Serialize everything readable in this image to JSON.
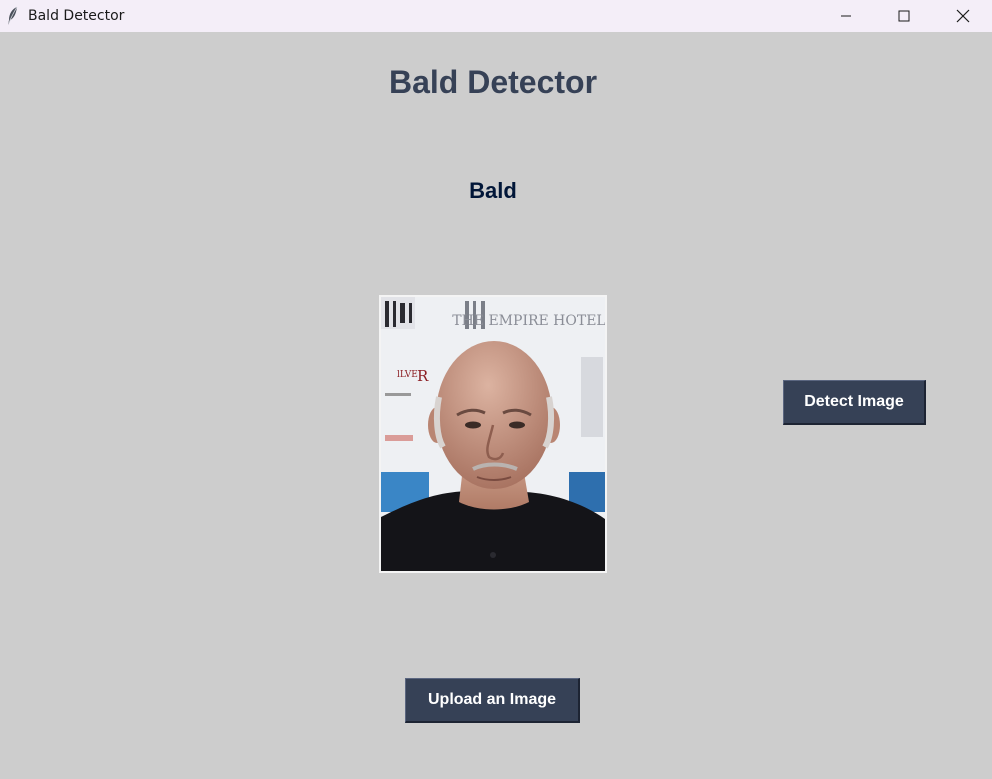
{
  "window": {
    "title": "Bald Detector",
    "app_icon": "feather-icon",
    "controls": {
      "minimize": "minimize-icon",
      "maximize": "maximize-icon",
      "close": "close-icon"
    }
  },
  "main": {
    "heading": "Bald Detector",
    "result_label": "Bald",
    "image": {
      "kind": "photo-portrait",
      "sign_text": "THE EMPIRE HOTEL"
    },
    "detect_button_label": "Detect Image",
    "upload_button_label": "Upload an Image"
  },
  "colors": {
    "background": "#cdcdcd",
    "titlebar": "#f4eef8",
    "heading": "#364156",
    "result": "#011638",
    "button_bg": "#364156",
    "button_text": "#ffffff"
  }
}
